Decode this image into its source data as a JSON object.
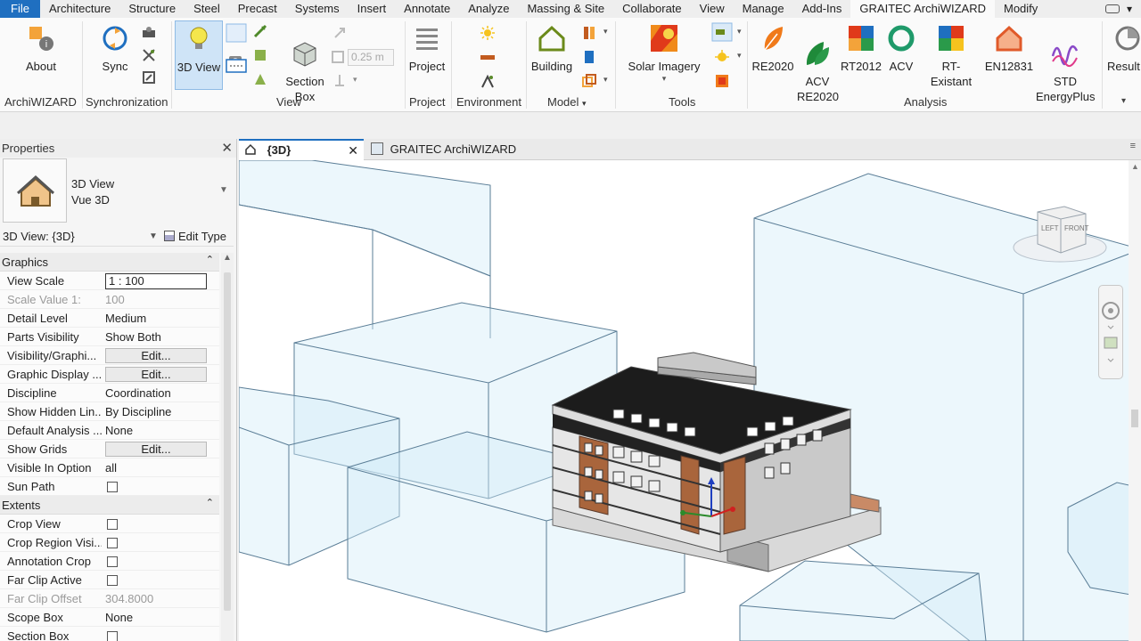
{
  "menu": {
    "tabs": [
      "File",
      "Architecture",
      "Structure",
      "Steel",
      "Precast",
      "Systems",
      "Insert",
      "Annotate",
      "Analyze",
      "Massing & Site",
      "Collaborate",
      "View",
      "Manage",
      "Add-Ins",
      "GRAITEC ArchiWIZARD",
      "Modify"
    ],
    "active": "GRAITEC ArchiWIZARD"
  },
  "ribbon": {
    "buttons": {
      "about": "About",
      "sync": "Sync",
      "view3d": "3D View",
      "section_box": "Section\nBox",
      "offset_value": "0.25 m",
      "project": "Project",
      "building": "Building",
      "solar": "Solar Imagery",
      "re2020": "RE2020",
      "acv_re2020": "ACV\nRE2020",
      "rt2012": "RT2012",
      "acv": "ACV",
      "rt_existant": "RT-Existant",
      "en12831": "EN12831",
      "std_energyplus": "STD\nEnergyPlus",
      "results": "Result"
    },
    "panels": {
      "archiwizard": "ArchiWIZARD",
      "synchronization": "Synchronization",
      "view": "View",
      "project": "Project",
      "environment": "Environment",
      "model": "Model",
      "tools": "Tools",
      "analysis": "Analysis"
    }
  },
  "properties": {
    "title": "Properties",
    "type_name_1": "3D View",
    "type_name_2": "Vue 3D",
    "instance": "3D View: {3D}",
    "edit_type": "Edit Type",
    "sections": [
      {
        "name": "Graphics",
        "rows": [
          {
            "name": "View Scale",
            "value": "1 : 100",
            "kind": "boxed"
          },
          {
            "name": "Scale Value    1:",
            "value": "100",
            "kind": "disabled"
          },
          {
            "name": "Detail Level",
            "value": "Medium",
            "kind": "text"
          },
          {
            "name": "Parts Visibility",
            "value": "Show Both",
            "kind": "text"
          },
          {
            "name": "Visibility/Graphi...",
            "value": "Edit...",
            "kind": "button"
          },
          {
            "name": "Graphic Display ...",
            "value": "Edit...",
            "kind": "button"
          },
          {
            "name": "Discipline",
            "value": "Coordination",
            "kind": "text"
          },
          {
            "name": "Show Hidden Lin...",
            "value": "By Discipline",
            "kind": "text"
          },
          {
            "name": "Default Analysis ...",
            "value": "None",
            "kind": "text"
          },
          {
            "name": "Show Grids",
            "value": "Edit...",
            "kind": "button"
          },
          {
            "name": "Visible In Option",
            "value": "all",
            "kind": "text"
          },
          {
            "name": "Sun Path",
            "value": "",
            "kind": "check"
          }
        ]
      },
      {
        "name": "Extents",
        "rows": [
          {
            "name": "Crop View",
            "value": "",
            "kind": "check"
          },
          {
            "name": "Crop Region Visi...",
            "value": "",
            "kind": "check"
          },
          {
            "name": "Annotation Crop",
            "value": "",
            "kind": "check"
          },
          {
            "name": "Far Clip Active",
            "value": "",
            "kind": "check"
          },
          {
            "name": "Far Clip Offset",
            "value": "304.8000",
            "kind": "disabled"
          },
          {
            "name": "Scope Box",
            "value": "None",
            "kind": "text"
          },
          {
            "name": "Section Box",
            "value": "",
            "kind": "check"
          }
        ]
      }
    ]
  },
  "view_tabs": {
    "tab1": "{3D}",
    "tab2": "GRAITEC ArchiWIZARD"
  },
  "viewcube": {
    "left": "LEFT",
    "front": "FRONT"
  }
}
